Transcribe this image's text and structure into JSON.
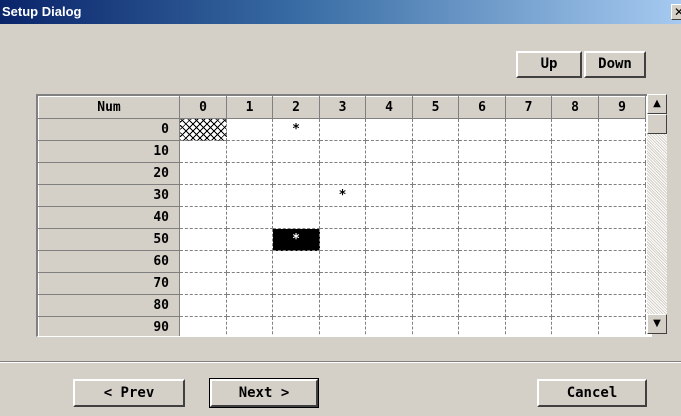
{
  "window": {
    "title": "Setup Dialog",
    "close_glyph": "✕"
  },
  "nav": {
    "up_label": "Up",
    "down_label": "Down"
  },
  "grid": {
    "corner_label": "Num",
    "columns": [
      "0",
      "1",
      "2",
      "3",
      "4",
      "5",
      "6",
      "7",
      "8",
      "9"
    ],
    "rows": [
      {
        "label": "0",
        "cells": [
          "",
          "",
          "*",
          "",
          "",
          "",
          "",
          "",
          "",
          ""
        ]
      },
      {
        "label": "10",
        "cells": [
          "",
          "",
          "",
          "",
          "",
          "",
          "",
          "",
          "",
          ""
        ]
      },
      {
        "label": "20",
        "cells": [
          "",
          "",
          "",
          "",
          "",
          "",
          "",
          "",
          "",
          ""
        ]
      },
      {
        "label": "30",
        "cells": [
          "",
          "",
          "",
          "*",
          "",
          "",
          "",
          "",
          "",
          ""
        ]
      },
      {
        "label": "40",
        "cells": [
          "",
          "",
          "",
          "",
          "",
          "",
          "",
          "",
          "",
          ""
        ]
      },
      {
        "label": "50",
        "cells": [
          "",
          "",
          "*",
          "",
          "",
          "",
          "",
          "",
          "",
          ""
        ]
      },
      {
        "label": "60",
        "cells": [
          "",
          "",
          "",
          "",
          "",
          "",
          "",
          "",
          "",
          ""
        ]
      },
      {
        "label": "70",
        "cells": [
          "",
          "",
          "",
          "",
          "",
          "",
          "",
          "",
          "",
          ""
        ]
      },
      {
        "label": "80",
        "cells": [
          "",
          "",
          "",
          "",
          "",
          "",
          "",
          "",
          "",
          ""
        ]
      },
      {
        "label": "90",
        "cells": [
          "",
          "",
          "",
          "",
          "",
          "",
          "",
          "",
          "",
          ""
        ]
      }
    ],
    "hatched_cell": {
      "row": 0,
      "col": 0
    },
    "selected_cell": {
      "row": 5,
      "col": 2
    }
  },
  "scrollbar": {
    "up_glyph": "▲",
    "down_glyph": "▼"
  },
  "footer": {
    "prev_label": "< Prev",
    "next_label": "Next >",
    "cancel_label": "Cancel"
  }
}
